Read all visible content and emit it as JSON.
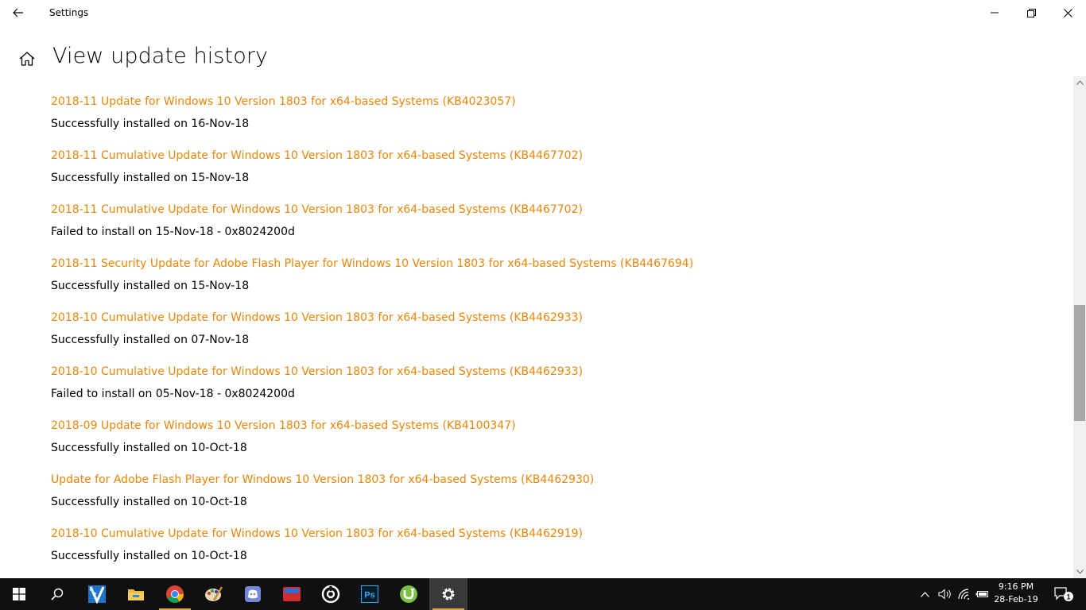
{
  "window": {
    "title": "Settings"
  },
  "header": {
    "title": "View update history"
  },
  "updates": [
    {
      "name": "2018-11 Update for Windows 10 Version 1803 for x64-based Systems (KB4023057)",
      "status": "Successfully installed on 16-Nov-18"
    },
    {
      "name": "2018-11 Cumulative Update for Windows 10 Version 1803 for x64-based Systems (KB4467702)",
      "status": "Successfully installed on 15-Nov-18"
    },
    {
      "name": "2018-11 Cumulative Update for Windows 10 Version 1803 for x64-based Systems (KB4467702)",
      "status": "Failed to install on 15-Nov-18 - 0x8024200d"
    },
    {
      "name": "2018-11 Security Update for Adobe Flash Player for Windows 10 Version 1803 for x64-based Systems (KB4467694)",
      "status": "Successfully installed on 15-Nov-18"
    },
    {
      "name": "2018-10 Cumulative Update for Windows 10 Version 1803 for x64-based Systems (KB4462933)",
      "status": "Successfully installed on 07-Nov-18"
    },
    {
      "name": "2018-10 Cumulative Update for Windows 10 Version 1803 for x64-based Systems (KB4462933)",
      "status": "Failed to install on 05-Nov-18 - 0x8024200d"
    },
    {
      "name": "2018-09 Update for Windows 10 Version 1803 for x64-based Systems (KB4100347)",
      "status": "Successfully installed on 10-Oct-18"
    },
    {
      "name": "Update for Adobe Flash Player for Windows 10 Version 1803 for x64-based Systems (KB4462930)",
      "status": "Successfully installed on 10-Oct-18"
    },
    {
      "name": "2018-10 Cumulative Update for Windows 10 Version 1803 for x64-based Systems (KB4462919)",
      "status": "Successfully installed on 10-Oct-18"
    }
  ],
  "colors": {
    "link": "#e8860b",
    "taskbar": "#101010",
    "accent_underline": "#e8a33d"
  },
  "taskbar": {
    "apps": [
      {
        "icon": "windows-start-icon"
      },
      {
        "icon": "search-icon"
      },
      {
        "icon": "app-blue-icon"
      },
      {
        "icon": "file-explorer-icon"
      },
      {
        "icon": "chrome-icon"
      },
      {
        "icon": "paint-icon"
      },
      {
        "icon": "discord-icon"
      },
      {
        "icon": "red-app-icon"
      },
      {
        "icon": "target-app-icon"
      },
      {
        "icon": "photoshop-icon",
        "label": "Ps"
      },
      {
        "icon": "utorrent-icon"
      },
      {
        "icon": "settings-gear-icon"
      }
    ],
    "clock": {
      "time": "9:16 PM",
      "date": "28-Feb-19"
    },
    "notifications_count": "1"
  }
}
